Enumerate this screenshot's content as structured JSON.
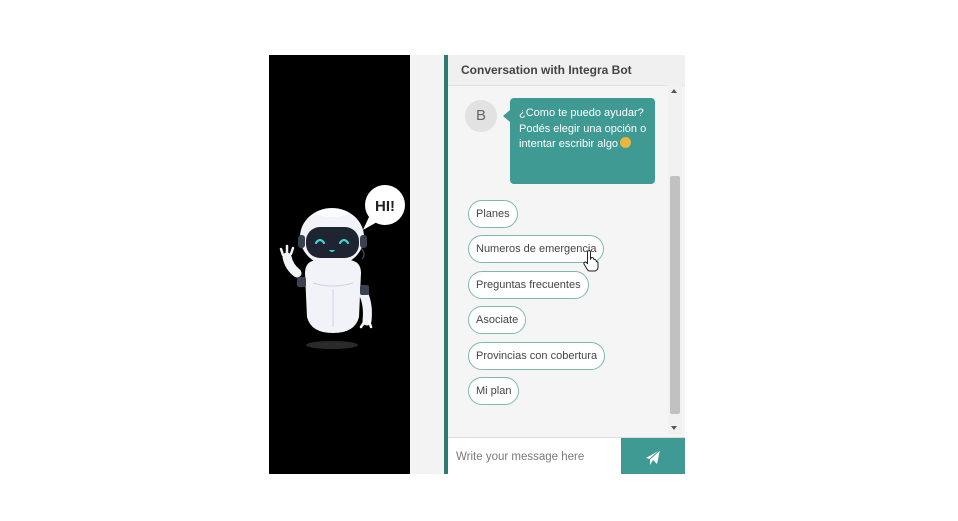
{
  "robot": {
    "speech_bubble_text": "HI!"
  },
  "chat": {
    "header_title": "Conversation with Integra Bot",
    "avatar_initial": "B",
    "bot_message": "¿Como te puedo ayudar? Podés elegir una opción o intentar escribir algo",
    "options": [
      "Planes",
      "Numeros de emergencia",
      "Preguntas frecuentes",
      "Asociate",
      "Provincias con cobertura",
      "Mi plan"
    ],
    "input_placeholder": "Write your message here",
    "send_icon": "paper-plane-icon"
  },
  "colors": {
    "accent": "#3e9a93",
    "robot_panel": "#000000"
  }
}
